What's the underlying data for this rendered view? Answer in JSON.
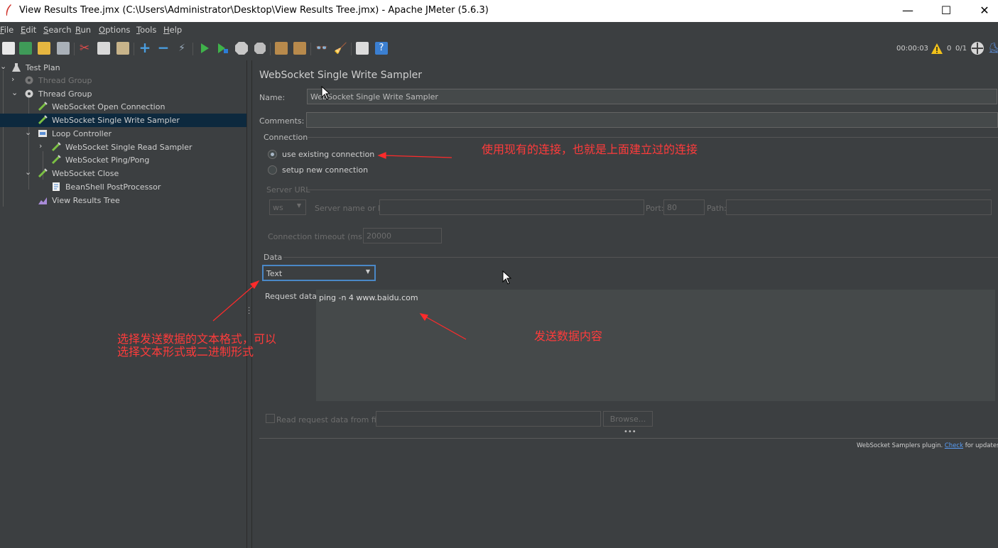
{
  "window": {
    "title": "View Results Tree.jmx (C:\\Users\\Administrator\\Desktop\\View Results Tree.jmx) - Apache JMeter (5.6.3)",
    "minimize": "—",
    "maximize": "☐",
    "close": "✕"
  },
  "menu": [
    "File",
    "Edit",
    "Search",
    "Run",
    "Options",
    "Tools",
    "Help"
  ],
  "toolbar": {
    "timer": "00:00:03",
    "warnings": "0",
    "threads": "0/1"
  },
  "tree": {
    "items": [
      {
        "label": "Test Plan",
        "icon": "test-plan-icon"
      },
      {
        "label": "Thread Group",
        "icon": "gear-icon",
        "disabled": true
      },
      {
        "label": "Thread Group",
        "icon": "gear-icon"
      },
      {
        "label": "WebSocket Open Connection",
        "icon": "pipette-icon"
      },
      {
        "label": "WebSocket Single Write Sampler",
        "icon": "pipette-icon",
        "selected": true
      },
      {
        "label": "Loop Controller",
        "icon": "controller-icon"
      },
      {
        "label": "WebSocket Single Read Sampler",
        "icon": "pipette-icon"
      },
      {
        "label": "WebSocket Ping/Pong",
        "icon": "pipette-icon"
      },
      {
        "label": "WebSocket Close",
        "icon": "pipette-icon"
      },
      {
        "label": "BeanShell PostProcessor",
        "icon": "script-icon"
      },
      {
        "label": "View Results Tree",
        "icon": "chart-icon"
      }
    ]
  },
  "panel": {
    "title": "WebSocket Single Write Sampler",
    "name_label": "Name:",
    "name_value": "WebSocket Single Write Sampler",
    "comments_label": "Comments:",
    "comments_value": "",
    "connection_label": "Connection",
    "use_existing": "use existing connection",
    "setup_new": "setup new connection",
    "server_url_label": "Server URL",
    "protocol_value": "ws",
    "server_label": "Server name or IP:",
    "server_value": "",
    "port_label": "Port:",
    "port_value": "80",
    "path_label": "Path:",
    "path_value": "",
    "timeout_label": "Connection timeout (ms):",
    "timeout_value": "20000",
    "data_label": "Data",
    "data_type": "Text",
    "request_label": "Request data:",
    "request_value": "ping  -n 4 www.baidu.com",
    "read_file_label": "Read request data from file:",
    "browse_label": "Browse...",
    "footer_prefix": "WebSocket Samplers plugin.",
    "footer_link": "Check",
    "footer_suffix": "for updates."
  },
  "annotations": {
    "connection_note": "使用现有的连接，也就是上面建立过的连接",
    "format_note_line1": "选择发送数据的文本格式，可以",
    "format_note_line2": "选择文本形式或二进制形式",
    "content_note": "发送数据内容"
  },
  "colors": {
    "background": "#3c3f41",
    "selected_row": "#0d293e",
    "annotation": "#ff3b3b",
    "link": "#589df6"
  }
}
